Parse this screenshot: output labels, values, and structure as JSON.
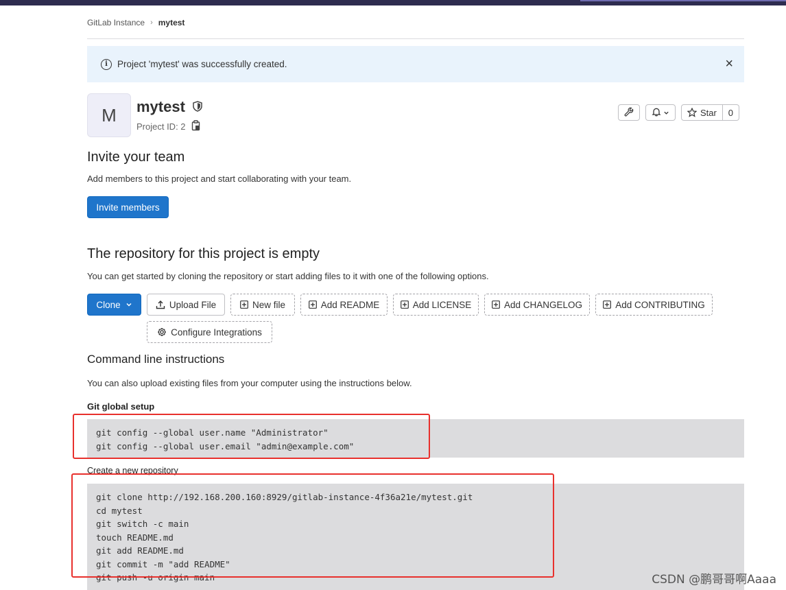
{
  "breadcrumb": {
    "root": "GitLab Instance",
    "current": "mytest"
  },
  "alert": {
    "message": "Project 'mytest' was successfully created.",
    "close_icon": "×"
  },
  "project": {
    "avatar_letter": "M",
    "name": "mytest",
    "id_label": "Project ID: 2",
    "star_label": "Star",
    "star_count": "0"
  },
  "invite": {
    "title": "Invite your team",
    "description": "Add members to this project and start collaborating with your team.",
    "button_label": "Invite members"
  },
  "repo": {
    "title": "The repository for this project is empty",
    "description": "You can get started by cloning the repository or start adding files to it with one of the following options.",
    "buttons": {
      "clone": "Clone",
      "upload": "Upload File",
      "new_file": "New file",
      "readme": "Add README",
      "license": "Add LICENSE",
      "changelog": "Add CHANGELOG",
      "contributing": "Add CONTRIBUTING",
      "integrations": "Configure Integrations"
    }
  },
  "cli": {
    "title": "Command line instructions",
    "description": "You can also upload existing files from your computer using the instructions below.",
    "global_setup_label": "Git global setup",
    "global_setup_code": "git config --global user.name \"Administrator\"\ngit config --global user.email \"admin@example.com\"",
    "new_repo_label": "Create a new repository",
    "new_repo_code": "git clone http://192.168.200.160:8929/gitlab-instance-4f36a21e/mytest.git\ncd mytest\ngit switch -c main\ntouch README.md\ngit add README.md\ngit commit -m \"add README\"\ngit push -u origin main"
  },
  "watermark": "CSDN @鹏哥哥啊Aaaa",
  "colors": {
    "primary": "#1f75cb",
    "alert_bg": "#e9f3fc",
    "code_bg": "#dcdcde",
    "highlight": "#e8302c"
  }
}
